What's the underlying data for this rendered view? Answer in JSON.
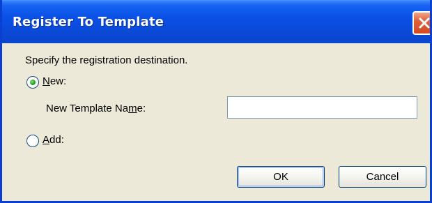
{
  "window": {
    "title": "Register To Template",
    "close_icon": "close-icon"
  },
  "dialog": {
    "instruction": "Specify the registration destination.",
    "new_option": {
      "mnemonic": "N",
      "rest": "ew:",
      "selected": true
    },
    "template_name": {
      "label_before": "New Template Na",
      "mnemonic": "m",
      "label_after": "e:",
      "value": "",
      "placeholder": ""
    },
    "add_option": {
      "mnemonic": "A",
      "rest": "dd:",
      "selected": false
    },
    "ok_label": "OK",
    "cancel_label": "Cancel"
  },
  "colors": {
    "titlebar": "#0a50e6",
    "dialog_bg": "#ece9d8",
    "close_button": "#d44a22",
    "radio_dot": "#21a121"
  }
}
